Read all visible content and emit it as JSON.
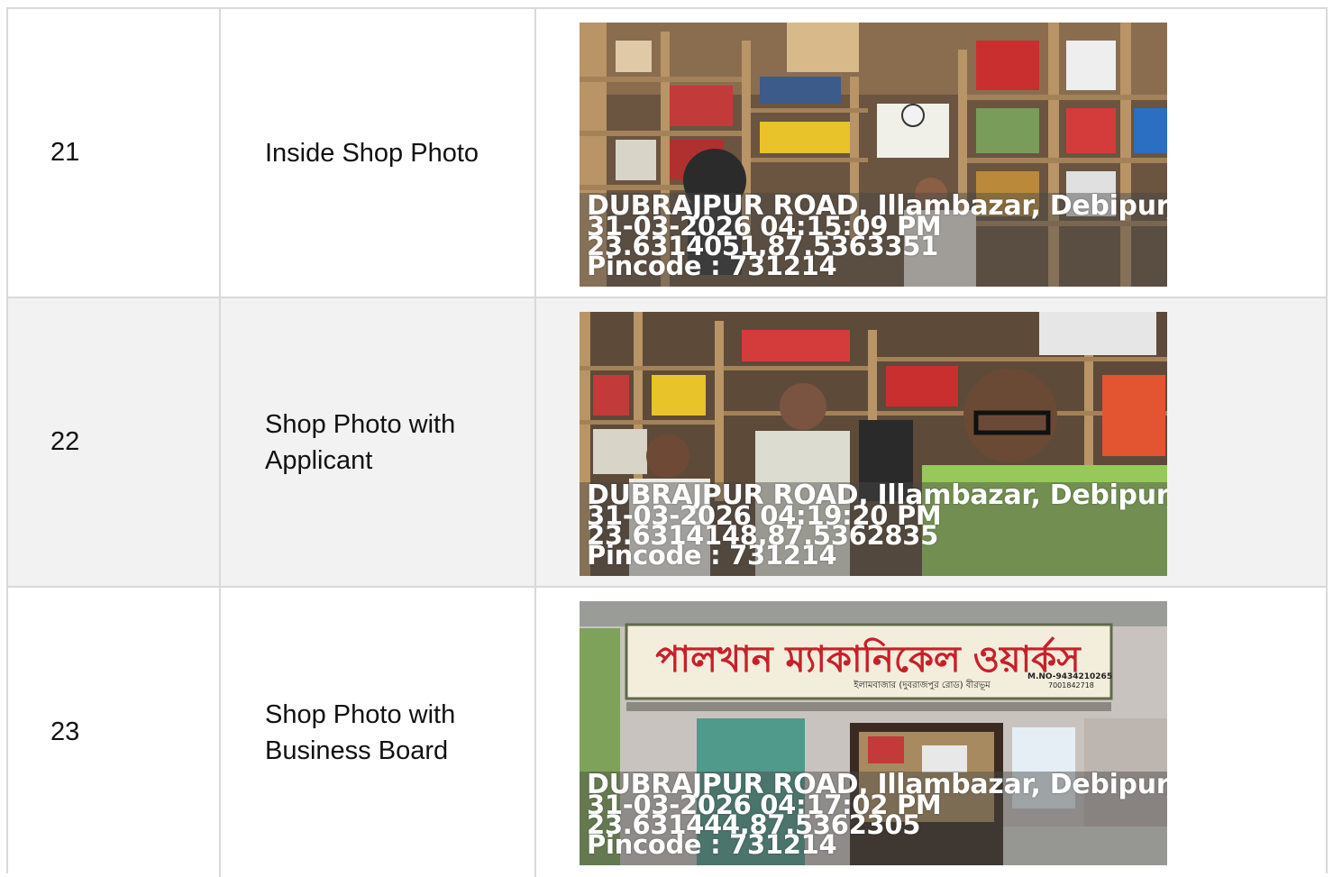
{
  "rows": [
    {
      "number": "21",
      "label": "Inside Shop Photo",
      "photo_scene": "shop-interior-shelves",
      "stamp": {
        "address": "DUBRAJPUR ROAD, Illambazar, Debipur, We",
        "datetime": "31-03-2026 04:15:09 PM",
        "coords": "23.6314051,87.5363351",
        "pincode": "Pincode : 731214"
      }
    },
    {
      "number": "22",
      "label": "Shop Photo with Applicant",
      "photo_scene": "shop-interior-with-people",
      "stamp": {
        "address": "DUBRAJPUR ROAD, Illambazar, Debipur, We",
        "datetime": "31-03-2026 04:19:20 PM",
        "coords": "23.6314148,87.5362835",
        "pincode": "Pincode : 731214"
      }
    },
    {
      "number": "23",
      "label": "Shop Photo with Business Board",
      "photo_scene": "shop-front-signboard",
      "signboard": {
        "name": "পালখান ম্যাকানিকেল ওয়ার্কস",
        "subline": "ইলামবাজার (দুবরাজপুর রোড) বীরভূম",
        "phone": "M.NO-9434210265",
        "phone2": "7001842718"
      },
      "stamp": {
        "address": "DUBRAJPUR ROAD, Illambazar, Debipur, We",
        "datetime": "31-03-2026 04:17:02 PM",
        "coords": "23.631444,87.5362305",
        "pincode": "Pincode : 731214"
      }
    }
  ],
  "colors": {
    "border": "#d9d9d9",
    "alt_row": "#f2f2f2",
    "sign_red": "#c8202a"
  }
}
